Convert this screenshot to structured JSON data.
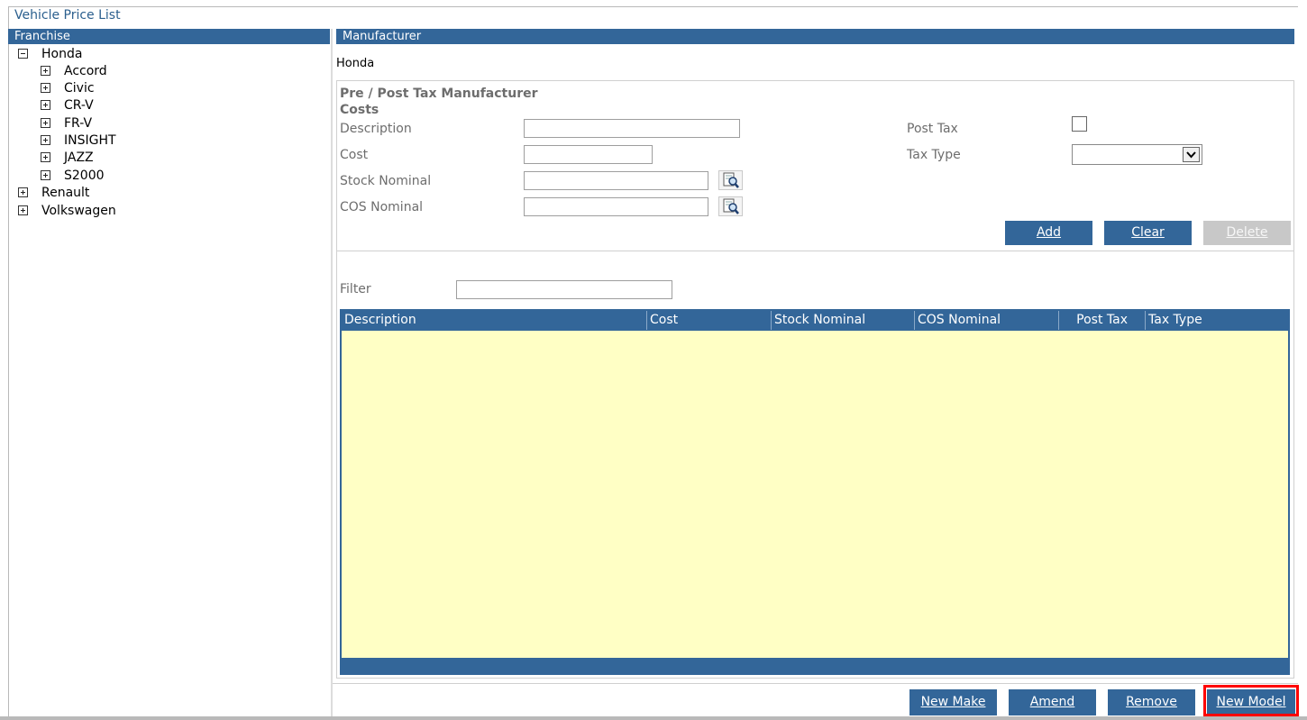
{
  "app": {
    "title": "Vehicle Price List"
  },
  "franchise": {
    "header": "Franchise",
    "tree": [
      {
        "label": "Honda",
        "expanded": true,
        "level": 0
      },
      {
        "label": "Accord",
        "expanded": false,
        "level": 1
      },
      {
        "label": "Civic",
        "expanded": false,
        "level": 1
      },
      {
        "label": "CR-V",
        "expanded": false,
        "level": 1
      },
      {
        "label": "FR-V",
        "expanded": false,
        "level": 1
      },
      {
        "label": "INSIGHT",
        "expanded": false,
        "level": 1
      },
      {
        "label": "JAZZ",
        "expanded": false,
        "level": 1
      },
      {
        "label": "S2000",
        "expanded": false,
        "level": 1
      },
      {
        "label": "Renault",
        "expanded": false,
        "level": 0
      },
      {
        "label": "Volkswagen",
        "expanded": false,
        "level": 0
      }
    ]
  },
  "manufacturer": {
    "header": "Manufacturer",
    "name": "Honda",
    "costs": {
      "title": "Pre / Post Tax Manufacturer Costs",
      "description_label": "Description",
      "description_value": "",
      "cost_label": "Cost",
      "cost_value": "",
      "stock_nominal_label": "Stock Nominal",
      "stock_nominal_value": "",
      "cos_nominal_label": "COS Nominal",
      "cos_nominal_value": "",
      "post_tax_label": "Post Tax",
      "post_tax_checked": false,
      "tax_type_label": "Tax Type",
      "tax_type_value": "",
      "add_label": "Add",
      "clear_label": "Clear",
      "delete_label": "Delete"
    },
    "filter": {
      "label": "Filter",
      "value": ""
    },
    "grid": {
      "columns": [
        "Description",
        "Cost",
        "Stock Nominal",
        "COS Nominal",
        "Post Tax",
        "Tax Type"
      ],
      "rows": []
    }
  },
  "footer": {
    "new_make_label": "New Make",
    "amend_label": "Amend",
    "remove_label": "Remove",
    "new_model_label": "New Model"
  },
  "colors": {
    "accent": "#336699",
    "grid_body": "#ffffc5",
    "highlight": "#ff0000"
  }
}
